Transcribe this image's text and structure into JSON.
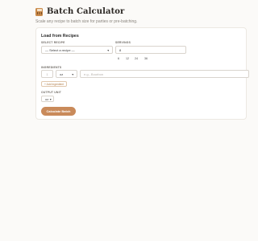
{
  "header": {
    "title": "Batch Calculator",
    "subtitle": "Scale any recipe to batch size for parties or pre-batching."
  },
  "recipes": {
    "section_title": "Load from Recipes",
    "select_label": "SELECT RECIPE",
    "select_value": "— Select a recipe —",
    "servings_label": "SERVINGS",
    "servings_value": "8",
    "presets": [
      "6",
      "12",
      "24",
      "36"
    ]
  },
  "ingredients": {
    "label": "INGREDIENTS",
    "amount_value": "1",
    "unit_value": "oz",
    "name_placeholder": "e.g., Bourbon",
    "add_label": "+ Add Ingredient"
  },
  "output": {
    "label": "OUTPUT UNIT",
    "unit_value": "oz"
  },
  "actions": {
    "calculate_label": "Calculate Batch"
  },
  "icons": {
    "title_icon": "calculator-icon"
  }
}
